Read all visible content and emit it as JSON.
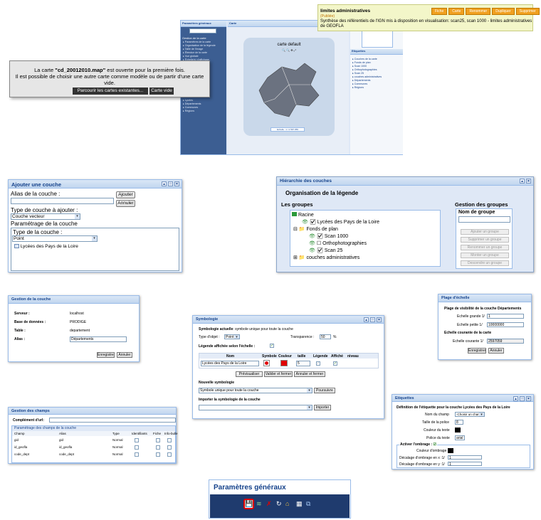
{
  "map_app": {
    "left_panel_title": "Paramètres généraux",
    "left_section": "Gestion de la carte",
    "left_items": [
      "Paramètres de la carte",
      "Organisation de la légende",
      "Taille de l'image",
      "Étendue de la carte",
      "Vue globale",
      "Échelle(s) d'affichage"
    ],
    "left_items_lower": [
      "Lycées",
      "Départements",
      "Communes",
      "Régions"
    ],
    "map_panel_title": "Carte",
    "map_inner_title": "carte default",
    "scale_text": "Echelle : 1 / 2 597 059",
    "right_panel_title": "Etiquettes",
    "right_tree": [
      "Couches de la carte",
      "Fonds de plan",
      "Scan 1000",
      "Orthophotographies",
      "Scan 25",
      "couches administratives",
      "Départements",
      "Communes",
      "Régions"
    ]
  },
  "metadata_card": {
    "title": "limites administratives",
    "status": "(Publiée)",
    "description": "Synthèse des référentiels de l'IGN mis à disposition en visualisation: scan25, scan 1000 - limites administratives de GEOFLA",
    "buttons": [
      "Fiche",
      "Carte",
      "Renommer",
      "Dupliquer",
      "Supprimer"
    ]
  },
  "alert": {
    "line1_prefix": "La carte ",
    "filename": "\"cd_20012010.map\"",
    "line1_suffix": " est ouverte pour la première fois.",
    "line2": "Il est possible de choisir une autre carte comme modèle ou de partir d'une carte vide.",
    "btn_browse": "Parcourir les cartes existantes...",
    "btn_empty": "Carte vide"
  },
  "add_layer": {
    "title": "Ajouter une couche",
    "alias_label": "Alias de la couche :",
    "btn_add": "Ajouter",
    "btn_cancel": "Annuler",
    "type_label": "Type de couche à ajouter :",
    "type_value": "Couche vecteur",
    "params_label": "Paramétrage de la couche",
    "layer_type_label": "Type de la couche :",
    "layer_type_value": "Point",
    "layer_name": "Lycées des Pays de la Loire"
  },
  "hierarchy": {
    "title": "Hiérarchie des couches",
    "subtitle": "Organisation de la légende",
    "groups_label": "Les groupes",
    "root": "Racine",
    "nodes": [
      "Lycées des Pays de la Loire",
      "Fonds de plan",
      "Scan 1000",
      "Orthophotographies",
      "Scan 25",
      "couches administratives"
    ],
    "manage_label": "Gestion des groupes",
    "group_name_label": "Nom de groupe",
    "actions": [
      "Ajouter un groupe",
      "Supprimer un groupe",
      "Renommer un groupe",
      "Monter un groupe",
      "Descendre un groupe"
    ]
  },
  "layer_mgmt": {
    "title": "Gestion de la couche",
    "server_label": "Serveur :",
    "server_value": "localhost",
    "db_label": "Base de données :",
    "db_value": "PRODIGE",
    "table_label": "Table :",
    "table_value": "departement",
    "alias_label": "Alias :",
    "alias_value": "Départements",
    "btn_save": "Enregistrer",
    "btn_cancel": "Annuler"
  },
  "symbology": {
    "title": "Symbologie",
    "current_label": "Symbologie actuelle",
    "current_value": ": symbole unique pour toute la couche",
    "obj_type_label": "Type d'objet :",
    "obj_type_value": "Point",
    "transparency_label": "Transparence :",
    "transparency_value": "50",
    "percent": "%",
    "legend_scale_label": "Légende affichée selon l'échelle :",
    "cols": [
      "Nom",
      "Symbole",
      "Couleur",
      "taille",
      "Légende",
      "Affiché",
      "niveau"
    ],
    "row_name": "Lycées des Pays de la Loire",
    "row_size": "5",
    "btn_preview": "Prévisualiser",
    "btn_validate": "Valider et fermer",
    "btn_cancel": "Annuler et fermer",
    "new_label": "Nouvelle symbologie",
    "new_value": "Symbole unique pour toute la couche",
    "btn_continue": "Poursuivre",
    "import_label": "Importer la symbologie de la couche",
    "btn_import": "Importer"
  },
  "scale_vis": {
    "title": "Plage d'échelle",
    "heading": "Plage de visibilité de la couche Départements",
    "big_label": "Echelle grande 1/",
    "big_value": "1",
    "small_label": "Echelle petite 1/",
    "small_value": "10000000",
    "current_heading": "Echelle courante de la carte",
    "current_label": "Echelle courante 1/",
    "current_value": "2597059",
    "btn_save": "Enregistrer",
    "btn_cancel": "Annuler"
  },
  "fields": {
    "title": "Gestion des champs",
    "url_label": "Complément d'url:",
    "section": "Paramétrage des champs de la couche",
    "cols": [
      "Champ",
      "Alias",
      "Type",
      "Identifiants",
      "Fiche",
      "Info-bulle"
    ],
    "rows": [
      {
        "champ": "gid",
        "alias": "gid",
        "type": "Normal"
      },
      {
        "champ": "id_geofla",
        "alias": "id_geofla",
        "type": "Normal"
      },
      {
        "champ": "code_dept",
        "alias": "code_dept",
        "type": "Normal"
      }
    ]
  },
  "labels": {
    "title": "Etiquettes",
    "heading": "Définition de l'étiquette pour la couche Lycées des Pays de la Loire",
    "field_label": "Nom du champ",
    "field_value": "-Choisir un champ-",
    "size_label": "Taille de la police",
    "size_value": "8",
    "color_label": "Couleur du texte",
    "font_label": "Police du texte",
    "font_value": "arial",
    "shadow_label": "Activer l'ombrage :",
    "shadow_color_label": "Couleur d'ombrage",
    "offset_x_label": "Décalage d'ombrage en x :1/",
    "offset_x_value": "1",
    "offset_y_label": "Décalage d'ombrage en y :1/",
    "offset_y_value": "1"
  },
  "general": {
    "title": "Paramètres généraux"
  },
  "colors": {
    "header_blue": "#15428b",
    "panel_bg": "#dfe8f6",
    "red": "#e00000",
    "orange": "#f0a020"
  }
}
